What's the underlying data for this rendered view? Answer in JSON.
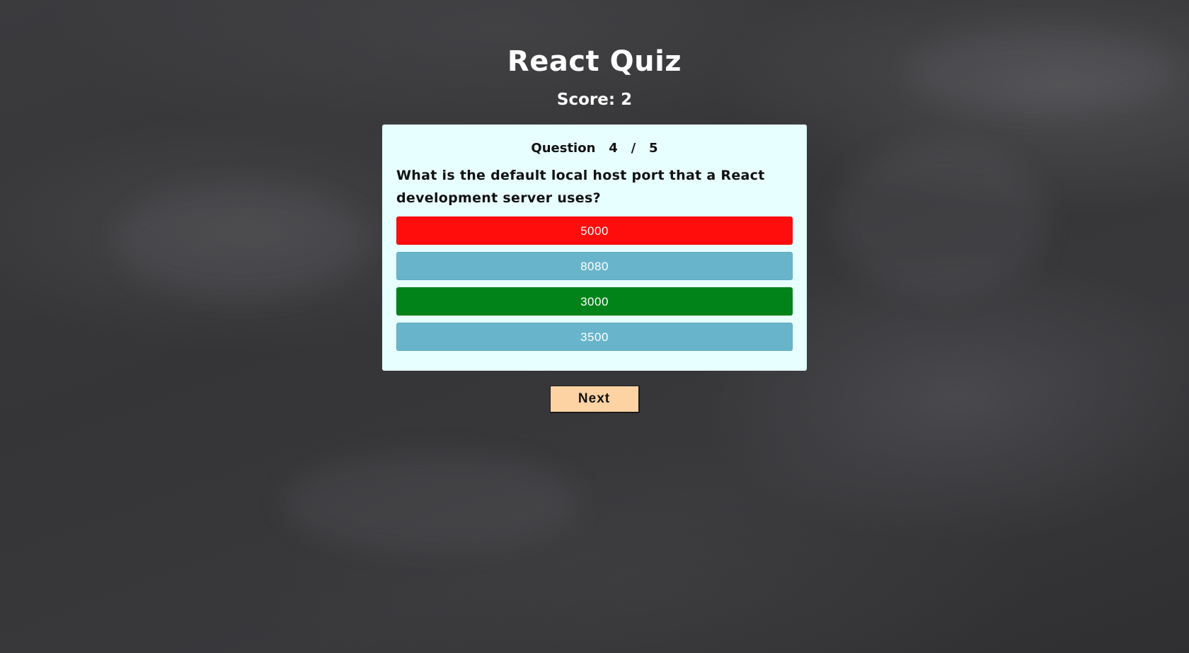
{
  "header": {
    "title": "React Quiz",
    "score_label": "Score:",
    "score_value": "2"
  },
  "question": {
    "counter_label": "Question",
    "current": "4",
    "separator": "/",
    "total": "5",
    "text": "What is the default local host port that a React development server uses?"
  },
  "answers": [
    {
      "label": "5000",
      "state": "incorrect",
      "color": "#ff0d0d"
    },
    {
      "label": "8080",
      "state": "neutral",
      "color": "#68b5cb"
    },
    {
      "label": "3000",
      "state": "correct",
      "color": "#028319"
    },
    {
      "label": "3500",
      "state": "neutral",
      "color": "#68b5cb"
    }
  ],
  "actions": {
    "next_label": "Next"
  },
  "colors": {
    "card_background": "#e8ffff",
    "next_button": "#fdd3a4",
    "background": "#3a3a3c"
  }
}
